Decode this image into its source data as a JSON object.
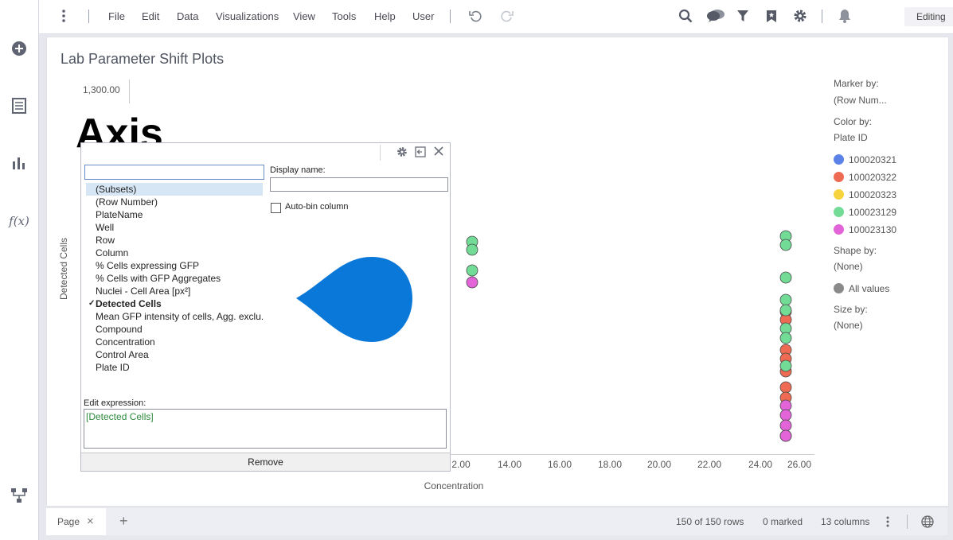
{
  "menu": {
    "file": "File",
    "edit": "Edit",
    "data": "Data",
    "visualizations": "Visualizations",
    "view": "View",
    "tools": "Tools",
    "help": "Help",
    "user": "User"
  },
  "mode": "Editing",
  "visual": {
    "title": "Lab Parameter Shift Plots",
    "overlay_text": "Axis",
    "y_top_tick": "1,300.00",
    "ylabel": "Detected Cells",
    "xlabel": "Concentration"
  },
  "legend": {
    "marker_by_label": "Marker by:",
    "marker_by_value": "(Row Num...",
    "color_by_label": "Color by:",
    "color_by_value": "Plate ID",
    "items": [
      {
        "label": "100020321",
        "color": "#5b82e8"
      },
      {
        "label": "100020322",
        "color": "#ee6a52"
      },
      {
        "label": "100020323",
        "color": "#f7d33d"
      },
      {
        "label": "100023129",
        "color": "#72dc96"
      },
      {
        "label": "100023130",
        "color": "#e264d8"
      }
    ],
    "shape_by_label": "Shape by:",
    "shape_by_value": "(None)",
    "all_values": "All values",
    "all_values_color": "#8a8a8a",
    "size_by_label": "Size by:",
    "size_by_value": "(None)"
  },
  "chart_data": {
    "type": "scatter",
    "xlabel": "Concentration",
    "ylabel": "Detected Cells",
    "x_ticks": [
      "2.00",
      "14.00",
      "16.00",
      "18.00",
      "20.00",
      "22.00",
      "24.00",
      "26.00"
    ],
    "points": [
      {
        "x": 12.5,
        "series": "100023129"
      },
      {
        "x": 12.5,
        "series": "100023129"
      },
      {
        "x": 12.5,
        "series": "100023129"
      },
      {
        "x": 12.5,
        "series": "100023130"
      },
      {
        "x": 25.0,
        "series": "100023129"
      },
      {
        "x": 25.0,
        "series": "100023129"
      },
      {
        "x": 25.0,
        "series": "100023129"
      },
      {
        "x": 25.0,
        "series": "100020322"
      },
      {
        "x": 25.0,
        "series": "100020322"
      },
      {
        "x": 25.0,
        "series": "100023129"
      },
      {
        "x": 25.0,
        "series": "100023129"
      },
      {
        "x": 25.0,
        "series": "100023129"
      },
      {
        "x": 25.0,
        "series": "100023129"
      },
      {
        "x": 25.0,
        "series": "100020322"
      },
      {
        "x": 25.0,
        "series": "100020322"
      },
      {
        "x": 25.0,
        "series": "100020322"
      },
      {
        "x": 25.0,
        "series": "100023129"
      },
      {
        "x": 25.0,
        "series": "100020322"
      },
      {
        "x": 25.0,
        "series": "100020322"
      },
      {
        "x": 25.0,
        "series": "100023130"
      },
      {
        "x": 25.0,
        "series": "100023130"
      },
      {
        "x": 25.0,
        "series": "100023130"
      },
      {
        "x": 25.0,
        "series": "100023130"
      },
      {
        "x": 25.0,
        "series": "100023130"
      }
    ]
  },
  "popup": {
    "search_value": "",
    "columns": [
      {
        "label": "(Subsets)",
        "selected": true,
        "checked": false,
        "bold": false
      },
      {
        "label": "(Row Number)",
        "selected": false,
        "checked": false,
        "bold": false
      },
      {
        "label": "PlateName",
        "selected": false,
        "checked": false,
        "bold": false
      },
      {
        "label": "Well",
        "selected": false,
        "checked": false,
        "bold": false
      },
      {
        "label": "Row",
        "selected": false,
        "checked": false,
        "bold": false
      },
      {
        "label": "Column",
        "selected": false,
        "checked": false,
        "bold": false
      },
      {
        "label": "% Cells expressing GFP",
        "selected": false,
        "checked": false,
        "bold": false
      },
      {
        "label": "% Cells with GFP Aggregates",
        "selected": false,
        "checked": false,
        "bold": false
      },
      {
        "label": "Nuclei - Cell Area [px²]",
        "selected": false,
        "checked": false,
        "bold": false
      },
      {
        "label": "Detected Cells",
        "selected": false,
        "checked": true,
        "bold": true
      },
      {
        "label": "Mean GFP intensity of cells, Agg. exclu...",
        "selected": false,
        "checked": false,
        "bold": false
      },
      {
        "label": "Compound",
        "selected": false,
        "checked": false,
        "bold": false
      },
      {
        "label": "Concentration",
        "selected": false,
        "checked": false,
        "bold": false
      },
      {
        "label": "Control Area",
        "selected": false,
        "checked": false,
        "bold": false
      },
      {
        "label": "Plate ID",
        "selected": false,
        "checked": false,
        "bold": false
      }
    ],
    "display_name_label": "Display name:",
    "display_name_value": "",
    "auto_bin_label": "Auto-bin column",
    "edit_expression_label": "Edit expression:",
    "expression": "[Detected Cells]",
    "remove_label": "Remove",
    "check_mark": "✓",
    "blob_color": "#0a78d8"
  },
  "statusbar": {
    "page_tab": "Page",
    "close_glyph": "×",
    "add_glyph": "+",
    "rows": "150 of 150 rows",
    "marked": "0 marked",
    "columns": "13 columns"
  }
}
